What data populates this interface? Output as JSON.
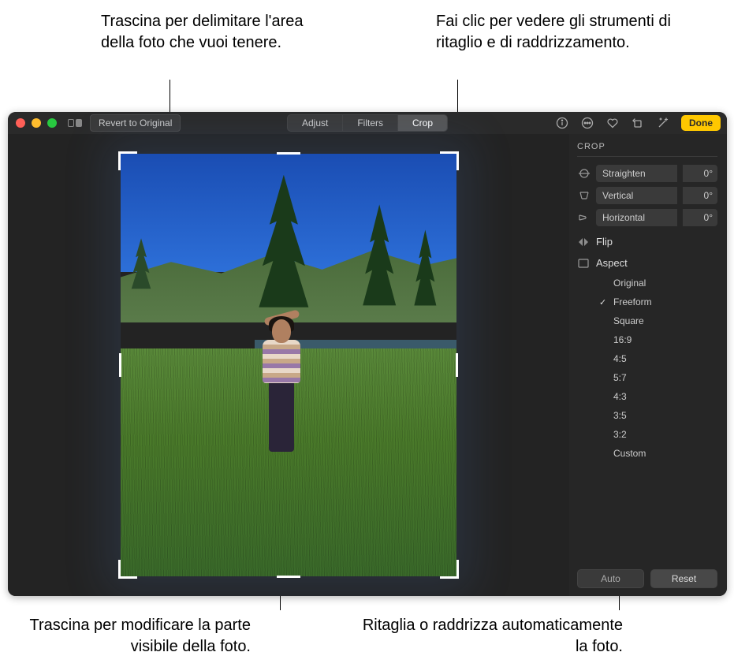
{
  "callouts": {
    "top_left": "Trascina per delimitare l'area della foto che vuoi tenere.",
    "top_right": "Fai clic per vedere gli strumenti di ritaglio e di raddrizzamento.",
    "bottom_left": "Trascina per modificare la parte visibile della foto.",
    "bottom_right": "Ritaglia o raddrizza automaticamente la foto."
  },
  "toolbar": {
    "revert": "Revert to Original",
    "tabs": {
      "adjust": "Adjust",
      "filters": "Filters",
      "crop": "Crop"
    },
    "done": "Done"
  },
  "panel": {
    "title": "CROP",
    "sliders": {
      "straighten": {
        "label": "Straighten",
        "value": "0°"
      },
      "vertical": {
        "label": "Vertical",
        "value": "0°"
      },
      "horizontal": {
        "label": "Horizontal",
        "value": "0°"
      }
    },
    "flip": "Flip",
    "aspect": "Aspect",
    "aspects": {
      "original": "Original",
      "freeform": "Freeform",
      "square": "Square",
      "r169": "16:9",
      "r45": "4:5",
      "r57": "5:7",
      "r43": "4:3",
      "r35": "3:5",
      "r32": "3:2",
      "custom": "Custom"
    },
    "selected_aspect": "freeform",
    "auto": "Auto",
    "reset": "Reset"
  }
}
